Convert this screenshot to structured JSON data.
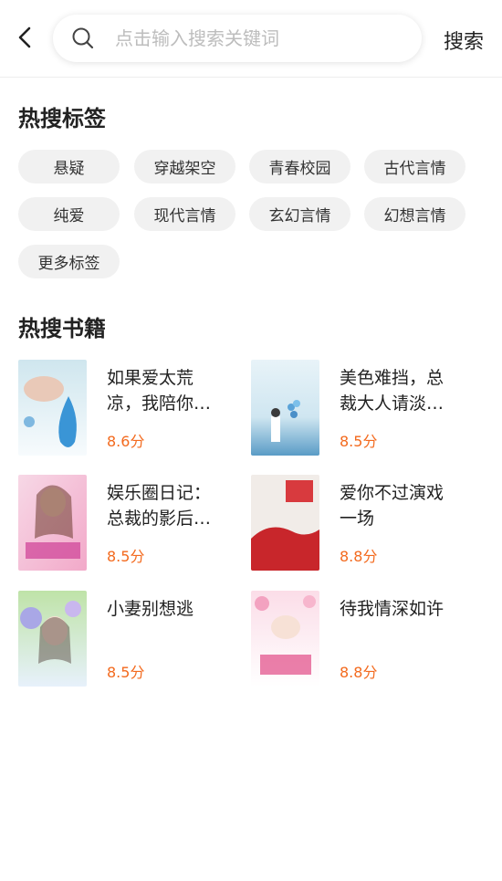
{
  "search": {
    "placeholder": "点击输入搜索关键词",
    "button_label": "搜索"
  },
  "hot_tags": {
    "title": "热搜标签",
    "items": [
      "悬疑",
      "穿越架空",
      "青春校园",
      "古代言情",
      "纯爱",
      "现代言情",
      "玄幻言情",
      "幻想言情",
      "更多标签"
    ]
  },
  "hot_books": {
    "title": "热搜书籍",
    "items": [
      {
        "title": "如果爱太荒凉，我陪你…",
        "score": "8.6分"
      },
      {
        "title": "美色难挡，总裁大人请淡…",
        "score": "8.5分"
      },
      {
        "title": "娱乐圈日记：总裁的影后…",
        "score": "8.5分"
      },
      {
        "title": "爱你不过演戏一场",
        "score": "8.8分"
      },
      {
        "title": "小妻别想逃",
        "score": "8.5分"
      },
      {
        "title": "待我情深如许",
        "score": "8.8分"
      }
    ]
  },
  "colors": {
    "accent_score": "#f36a1e",
    "tag_bg": "#f1f1f1"
  }
}
